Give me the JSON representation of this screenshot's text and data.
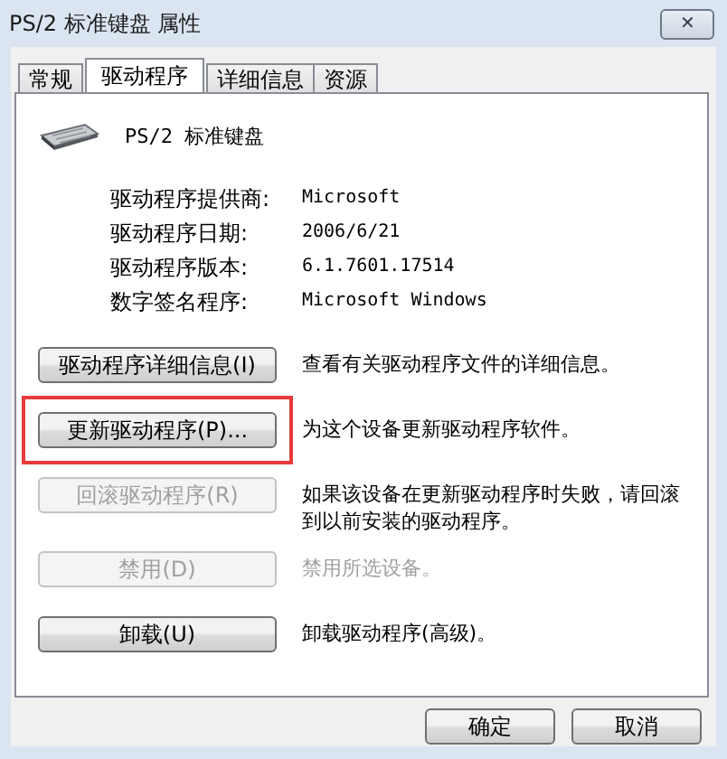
{
  "window": {
    "title": "PS/2 标准键盘 属性",
    "close": "✕"
  },
  "tabs": [
    {
      "label": "常规",
      "selected": false
    },
    {
      "label": "驱动程序",
      "selected": true
    },
    {
      "label": "详细信息",
      "selected": false
    },
    {
      "label": "资源",
      "selected": false
    }
  ],
  "device": {
    "name": "PS/2 标准键盘"
  },
  "properties": [
    {
      "label": "驱动程序提供商:",
      "value": "Microsoft"
    },
    {
      "label": "驱动程序日期:",
      "value": "2006/6/21"
    },
    {
      "label": "驱动程序版本:",
      "value": "6.1.7601.17514"
    },
    {
      "label": "数字签名程序:",
      "value": "Microsoft Windows"
    }
  ],
  "actions": [
    {
      "button": "驱动程序详细信息(I)",
      "disabled": false,
      "highlighted": false,
      "description": "查看有关驱动程序文件的详细信息。",
      "description_disabled": false
    },
    {
      "button": "更新驱动程序(P)...",
      "disabled": false,
      "highlighted": true,
      "description": "为这个设备更新驱动程序软件。",
      "description_disabled": false
    },
    {
      "button": "回滚驱动程序(R)",
      "disabled": true,
      "highlighted": false,
      "description": "如果该设备在更新驱动程序时失败，请回滚到以前安装的驱动程序。",
      "description_disabled": false
    },
    {
      "button": "禁用(D)",
      "disabled": true,
      "highlighted": false,
      "description": "禁用所选设备。",
      "description_disabled": true
    },
    {
      "button": "卸载(U)",
      "disabled": false,
      "highlighted": false,
      "description": "卸载驱动程序(高级)。",
      "description_disabled": false
    }
  ],
  "buttons": [
    "确定",
    "取消"
  ]
}
